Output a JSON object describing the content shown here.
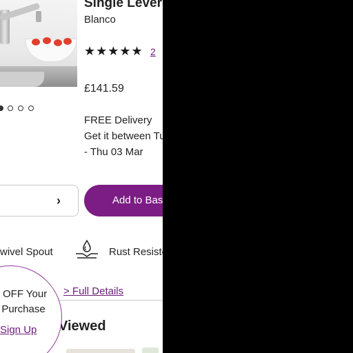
{
  "product": {
    "title": "Single Lever",
    "brand": "Blanco",
    "rating": {
      "stars": "★★★★★",
      "count": "2"
    },
    "price": "£141.59",
    "delivery": {
      "label": "FREE Delivery",
      "window": "Get it between Tu",
      "date": "- Thu 03 Mar"
    }
  },
  "carousel": {
    "total": 4,
    "active": 1
  },
  "actions": {
    "quantity_chevron": "›",
    "add_to_basket": "Add to Bas"
  },
  "features": {
    "swivel": "wivel Spout",
    "rust": "Rust Resisto"
  },
  "details_link": "> Full Details",
  "recently_viewed": {
    "title": "Viewed"
  },
  "promo": {
    "line1": "OFF Your",
    "line2": "t Purchase",
    "link": "Sign Up"
  },
  "colors": {
    "accent": "#7b1d84",
    "link": "#6b1a7a"
  }
}
